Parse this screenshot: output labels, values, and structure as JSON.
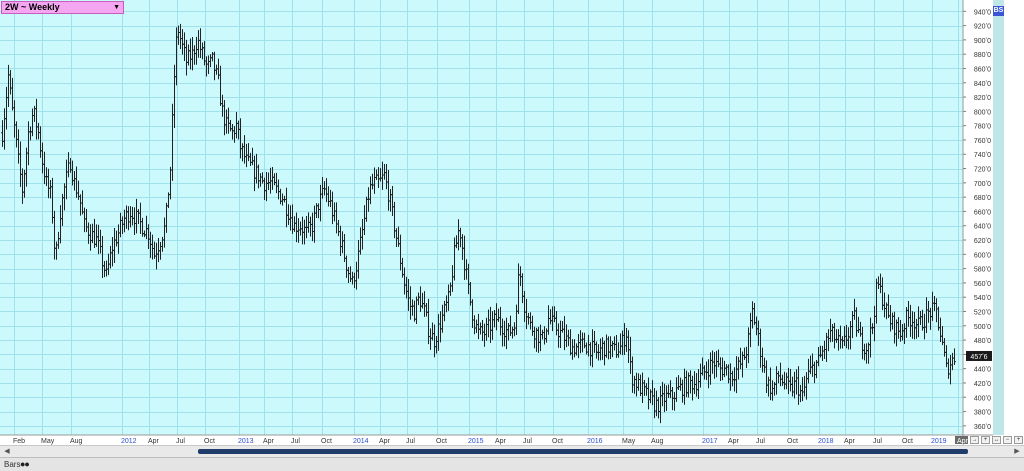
{
  "header": {
    "instrument_selector": "2W ~ Weekly",
    "tag": "BS"
  },
  "status": {
    "mode": "Bars",
    "dots": "●●"
  },
  "colors": {
    "background": "#ccfafc",
    "grid": "#9fe2ee",
    "bars": "#222222",
    "axis_text": "#333333",
    "year_text": "#2b4fd0",
    "last_price_bg": "#1a1a1a",
    "last_price_text": "#ffffff"
  },
  "nav_buttons": [
    "→",
    "+",
    "↔",
    "−",
    "+"
  ],
  "chart_data": {
    "type": "ohlc-bar",
    "y_tick_labels": [
      "360ʼ0",
      "380ʼ0",
      "400ʼ0",
      "420ʼ0",
      "440ʼ0",
      "460ʼ0",
      "480ʼ0",
      "500ʼ0",
      "520ʼ0",
      "540ʼ0",
      "560ʼ0",
      "580ʼ0",
      "600ʼ0",
      "620ʼ0",
      "640ʼ0",
      "660ʼ0",
      "680ʼ0",
      "700ʼ0",
      "720ʼ0",
      "740ʼ0",
      "760ʼ0",
      "780ʼ0",
      "800ʼ0",
      "820ʼ0",
      "840ʼ0",
      "860ʼ0",
      "880ʼ0",
      "900ʼ0",
      "920ʼ0",
      "940ʼ0"
    ],
    "y_ticks": [
      360,
      380,
      400,
      420,
      440,
      460,
      480,
      500,
      520,
      540,
      560,
      580,
      600,
      620,
      640,
      660,
      680,
      700,
      720,
      740,
      760,
      780,
      800,
      820,
      840,
      860,
      880,
      900,
      920,
      940
    ],
    "ylim": [
      350,
      953
    ],
    "last_price_label": "457ʼ6",
    "last_price": 457.75,
    "x_tick_labels": [
      "Feb",
      "May",
      "Aug",
      "2012",
      "Apr",
      "Jul",
      "Oct",
      "2013",
      "Apr",
      "Jul",
      "Oct",
      "2014",
      "Apr",
      "Jul",
      "Oct",
      "2015",
      "Apr",
      "Jul",
      "Oct",
      "2016",
      "May",
      "Aug",
      "2017",
      "Apr",
      "Jul",
      "Oct",
      "2018",
      "Apr",
      "Jul",
      "Oct",
      "2019",
      "Apr"
    ],
    "x_ticks": [
      14,
      42,
      71,
      122,
      149,
      177,
      205,
      239,
      264,
      292,
      322,
      354,
      380,
      407,
      437,
      469,
      496,
      524,
      553,
      588,
      623,
      652,
      703,
      729,
      757,
      788,
      819,
      845,
      874,
      903,
      932,
      958
    ],
    "x_year_labels": [
      "2012",
      "2013",
      "2014",
      "2015",
      "2016",
      "2017",
      "2018",
      "2019"
    ],
    "x_highlight": "Apr",
    "weeks_range": [
      2,
      955
    ],
    "price_path": [
      [
        2,
        770
      ],
      [
        8,
        850
      ],
      [
        12,
        800
      ],
      [
        18,
        730
      ],
      [
        22,
        690
      ],
      [
        28,
        770
      ],
      [
        33,
        800
      ],
      [
        38,
        770
      ],
      [
        42,
        730
      ],
      [
        46,
        700
      ],
      [
        51,
        680
      ],
      [
        55,
        590
      ],
      [
        60,
        660
      ],
      [
        65,
        700
      ],
      [
        70,
        730
      ],
      [
        74,
        700
      ],
      [
        79,
        680
      ],
      [
        84,
        640
      ],
      [
        90,
        630
      ],
      [
        96,
        620
      ],
      [
        102,
        590
      ],
      [
        106,
        570
      ],
      [
        112,
        610
      ],
      [
        118,
        630
      ],
      [
        124,
        650
      ],
      [
        130,
        660
      ],
      [
        136,
        650
      ],
      [
        142,
        640
      ],
      [
        148,
        630
      ],
      [
        154,
        600
      ],
      [
        160,
        620
      ],
      [
        165,
        640
      ],
      [
        170,
        720
      ],
      [
        174,
        850
      ],
      [
        177,
        920
      ],
      [
        182,
        890
      ],
      [
        186,
        870
      ],
      [
        192,
        880
      ],
      [
        197,
        900
      ],
      [
        202,
        880
      ],
      [
        207,
        860
      ],
      [
        212,
        870
      ],
      [
        218,
        840
      ],
      [
        222,
        800
      ],
      [
        226,
        780
      ],
      [
        232,
        770
      ],
      [
        236,
        780
      ],
      [
        240,
        750
      ],
      [
        246,
        730
      ],
      [
        252,
        720
      ],
      [
        258,
        710
      ],
      [
        264,
        700
      ],
      [
        270,
        700
      ],
      [
        276,
        690
      ],
      [
        282,
        680
      ],
      [
        288,
        660
      ],
      [
        294,
        640
      ],
      [
        300,
        640
      ],
      [
        306,
        630
      ],
      [
        312,
        640
      ],
      [
        318,
        670
      ],
      [
        324,
        690
      ],
      [
        330,
        670
      ],
      [
        336,
        640
      ],
      [
        342,
        610
      ],
      [
        347,
        580
      ],
      [
        352,
        560
      ],
      [
        357,
        590
      ],
      [
        363,
        640
      ],
      [
        369,
        690
      ],
      [
        374,
        700
      ],
      [
        379,
        700
      ],
      [
        384,
        710
      ],
      [
        389,
        680
      ],
      [
        394,
        640
      ],
      [
        399,
        600
      ],
      [
        404,
        560
      ],
      [
        409,
        530
      ],
      [
        414,
        520
      ],
      [
        419,
        540
      ],
      [
        424,
        520
      ],
      [
        429,
        490
      ],
      [
        434,
        480
      ],
      [
        439,
        500
      ],
      [
        444,
        520
      ],
      [
        449,
        540
      ],
      [
        454,
        600
      ],
      [
        459,
        640
      ],
      [
        463,
        600
      ],
      [
        468,
        550
      ],
      [
        473,
        510
      ],
      [
        478,
        490
      ],
      [
        484,
        490
      ],
      [
        490,
        500
      ],
      [
        496,
        510
      ],
      [
        502,
        500
      ],
      [
        508,
        490
      ],
      [
        514,
        500
      ],
      [
        519,
        580
      ],
      [
        524,
        530
      ],
      [
        530,
        500
      ],
      [
        536,
        490
      ],
      [
        542,
        480
      ],
      [
        548,
        510
      ],
      [
        554,
        500
      ],
      [
        560,
        490
      ],
      [
        566,
        480
      ],
      [
        572,
        470
      ],
      [
        578,
        470
      ],
      [
        584,
        475
      ],
      [
        590,
        470
      ],
      [
        596,
        460
      ],
      [
        602,
        470
      ],
      [
        608,
        470
      ],
      [
        614,
        465
      ],
      [
        620,
        470
      ],
      [
        626,
        490
      ],
      [
        631,
        430
      ],
      [
        636,
        420
      ],
      [
        642,
        410
      ],
      [
        648,
        400
      ],
      [
        654,
        390
      ],
      [
        659,
        390
      ],
      [
        665,
        400
      ],
      [
        671,
        400
      ],
      [
        677,
        410
      ],
      [
        683,
        415
      ],
      [
        689,
        420
      ],
      [
        695,
        420
      ],
      [
        701,
        430
      ],
      [
        707,
        440
      ],
      [
        713,
        450
      ],
      [
        719,
        440
      ],
      [
        725,
        440
      ],
      [
        731,
        430
      ],
      [
        737,
        440
      ],
      [
        742,
        450
      ],
      [
        747,
        470
      ],
      [
        752,
        520
      ],
      [
        757,
        490
      ],
      [
        762,
        450
      ],
      [
        767,
        420
      ],
      [
        772,
        410
      ],
      [
        778,
        430
      ],
      [
        784,
        420
      ],
      [
        790,
        410
      ],
      [
        796,
        420
      ],
      [
        802,
        400
      ],
      [
        807,
        430
      ],
      [
        812,
        440
      ],
      [
        818,
        450
      ],
      [
        824,
        470
      ],
      [
        830,
        490
      ],
      [
        836,
        480
      ],
      [
        842,
        470
      ],
      [
        848,
        490
      ],
      [
        854,
        510
      ],
      [
        860,
        480
      ],
      [
        866,
        470
      ],
      [
        872,
        500
      ],
      [
        877,
        560
      ],
      [
        882,
        540
      ],
      [
        888,
        510
      ],
      [
        894,
        500
      ],
      [
        900,
        490
      ],
      [
        906,
        510
      ],
      [
        912,
        510
      ],
      [
        918,
        500
      ],
      [
        924,
        510
      ],
      [
        930,
        520
      ],
      [
        936,
        520
      ],
      [
        941,
        480
      ],
      [
        946,
        440
      ],
      [
        951,
        450
      ],
      [
        955,
        457.75
      ]
    ],
    "seed": 7
  }
}
